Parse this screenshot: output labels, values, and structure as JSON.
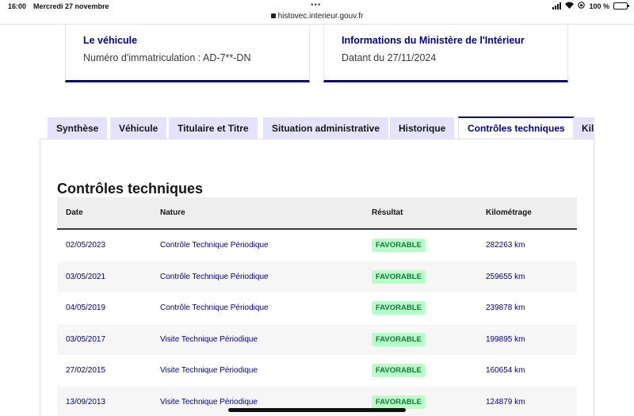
{
  "status_bar": {
    "time": "16:00",
    "date": "Mercredi 27 novembre",
    "battery": "100 %",
    "url": "histovec.interieur.gouv.fr"
  },
  "cards": [
    {
      "title": "Le véhicule",
      "text": "Numéro d'immatriculation : AD-7**-DN"
    },
    {
      "title": "Informations du Ministère de l'Intérieur",
      "text": "Datant du 27/11/2024"
    }
  ],
  "tabs": [
    {
      "label": "Synthèse",
      "active": false
    },
    {
      "label": "Véhicule",
      "active": false
    },
    {
      "label": "Titulaire et Titre",
      "active": false
    },
    {
      "label": "Situation administrative",
      "active": false
    },
    {
      "label": "Historique",
      "active": false
    },
    {
      "label": "Contrôles techniques",
      "active": true
    },
    {
      "label": "Kilo",
      "active": false
    }
  ],
  "section_title": "Contrôles techniques",
  "table": {
    "headers": [
      "Date",
      "Nature",
      "Résultat",
      "Kilométrage"
    ],
    "rows": [
      {
        "date": "02/05/2023",
        "nature": "Contrôle Technique Périodique",
        "result": "FAVORABLE",
        "km": "282263 km"
      },
      {
        "date": "03/05/2021",
        "nature": "Contrôle Technique Périodique",
        "result": "FAVORABLE",
        "km": "259655 km"
      },
      {
        "date": "04/05/2019",
        "nature": "Contrôle Technique Périodique",
        "result": "FAVORABLE",
        "km": "239878 km"
      },
      {
        "date": "03/05/2017",
        "nature": "Visite Technique Périodique",
        "result": "FAVORABLE",
        "km": "199895 km"
      },
      {
        "date": "27/02/2015",
        "nature": "Visite Technique Périodique",
        "result": "FAVORABLE",
        "km": "160654 km"
      },
      {
        "date": "13/09/2013",
        "nature": "Visite Technique Périodique",
        "result": "FAVORABLE",
        "km": "124879 km"
      }
    ]
  },
  "colors": {
    "accent": "#000091",
    "tab_bg": "#e3e3fd",
    "badge_bg": "#b8fec9",
    "badge_text": "#18753c"
  }
}
